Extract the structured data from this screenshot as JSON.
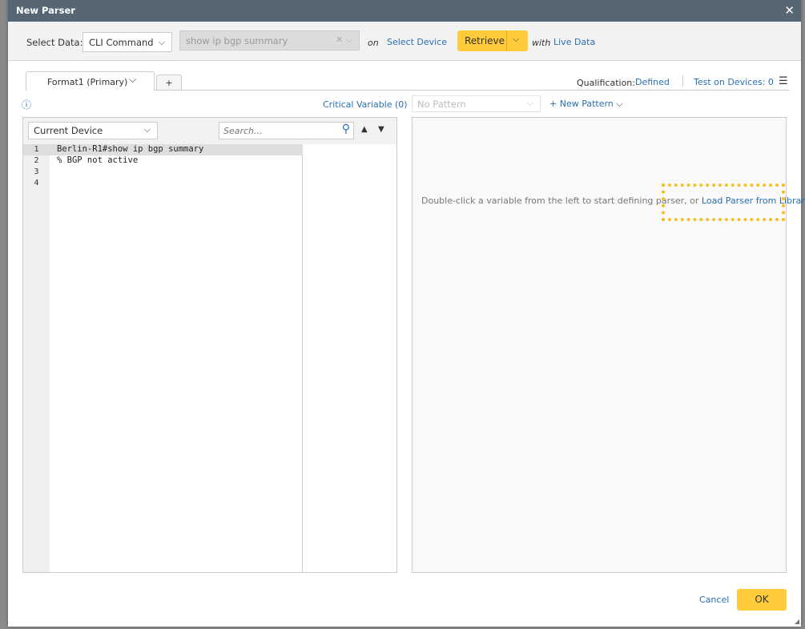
{
  "dialog": {
    "title": "New Parser"
  },
  "toolbar": {
    "select_data_label": "Select Data:",
    "data_type": "CLI Command",
    "command": "show ip bgp summary",
    "on": "on",
    "select_device": "Select Device",
    "retrieve": "Retrieve",
    "with": "with",
    "live_data": "Live Data"
  },
  "tabs": [
    {
      "label": "Format1 (Primary)"
    },
    {
      "label": "+"
    }
  ],
  "status": {
    "qualification_label": "Qualification:",
    "qualification_value": "Defined",
    "test_on_devices": "Test on Devices: 0"
  },
  "left": {
    "critical_variable": "Critical Variable (0)",
    "device_select": "Current Device",
    "search_placeholder": "Search...",
    "lines": [
      {
        "n": "1",
        "text": "Berlin-R1#show ip bgp summary"
      },
      {
        "n": "2",
        "text": "% BGP not active"
      },
      {
        "n": "3",
        "text": ""
      },
      {
        "n": "4",
        "text": ""
      }
    ]
  },
  "right": {
    "pattern_select": "No Pattern",
    "new_pattern": "+ New Pattern",
    "hint": "Double-click a variable from the left to start defining parser, or ",
    "hint_link": "Load Parser from Library."
  },
  "footer": {
    "cancel": "Cancel",
    "ok": "OK"
  },
  "colors": {
    "accent": "#ffcb3a",
    "link": "#2a6fb0",
    "titlebar": "#566773",
    "highlight": "#f5c024"
  }
}
